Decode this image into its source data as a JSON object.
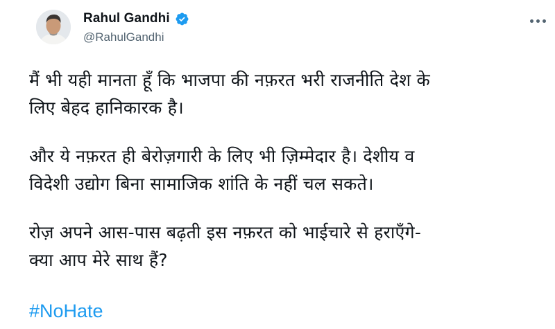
{
  "author": {
    "display_name": "Rahul Gandhi",
    "handle": "@RahulGandhi",
    "verified": true,
    "avatar_icon": "profile-photo"
  },
  "tweet": {
    "paragraphs": [
      [
        "मैं भी यही मानता हूँ कि भाजपा की नफ़रत भरी राजनीति देश के",
        "लिए बेहद हानिकारक है।"
      ],
      [
        "और ये नफ़रत ही बेरोज़गारी के लिए भी ज़िम्मेदार है। देशीय व",
        "विदेशी उद्योग बिना सामाजिक शांति के नहीं चल सकते।"
      ],
      [
        "रोज़ अपने आस-पास बढ़ती इस नफ़रत को भाईचारे से हराएँगे-",
        "क्या आप मेरे साथ हैं?"
      ]
    ],
    "hashtag": "#NoHate"
  },
  "colors": {
    "text": "#0f1419",
    "secondary": "#536471",
    "accent": "#1d9bf0"
  },
  "icons": {
    "verified": "verified-badge-icon",
    "more": "more-options-icon"
  }
}
